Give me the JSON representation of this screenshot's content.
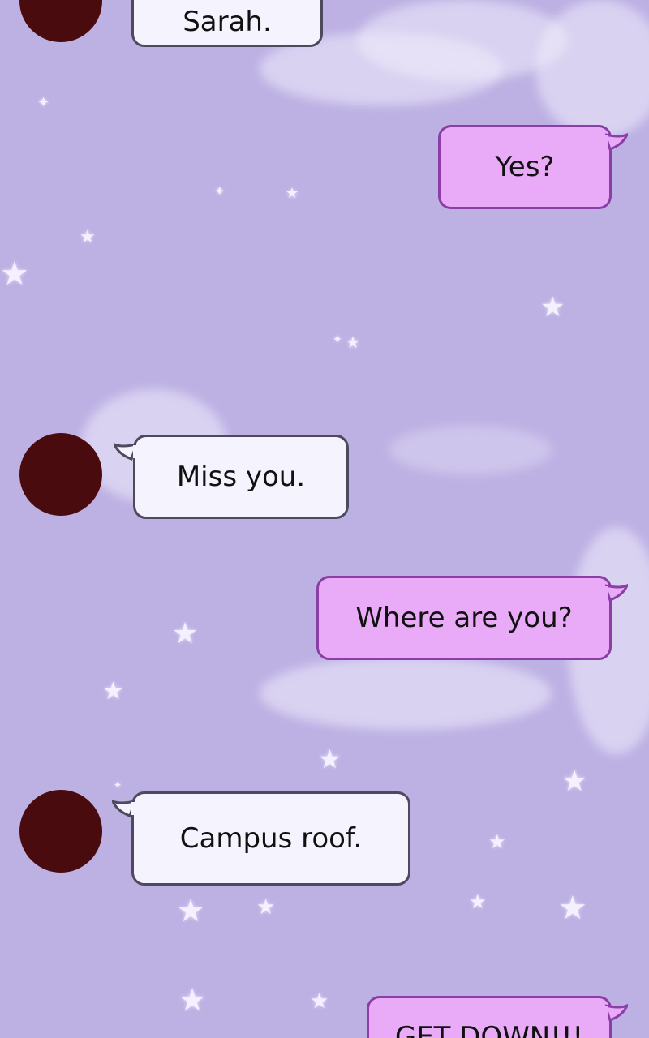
{
  "theme": {
    "background": "#bdb1e4",
    "incoming_bubble": "#f5f3fd",
    "incoming_border": "#4c4a5c",
    "outgoing_bubble": "#e9abf7",
    "outgoing_border": "#8a3ea6",
    "avatar_color": "#4a0b0e"
  },
  "decor": {
    "star_icon": "star-icon",
    "cloud_icon": "cloud-icon"
  },
  "chat": {
    "messages": [
      {
        "sender": "them",
        "text": "Sarah."
      },
      {
        "sender": "me",
        "text": "Yes?"
      },
      {
        "sender": "them",
        "text": "Miss you."
      },
      {
        "sender": "me",
        "text": "Where are you?"
      },
      {
        "sender": "them",
        "text": "Campus roof."
      },
      {
        "sender": "me",
        "text": "GET DOWN!!!"
      }
    ]
  }
}
